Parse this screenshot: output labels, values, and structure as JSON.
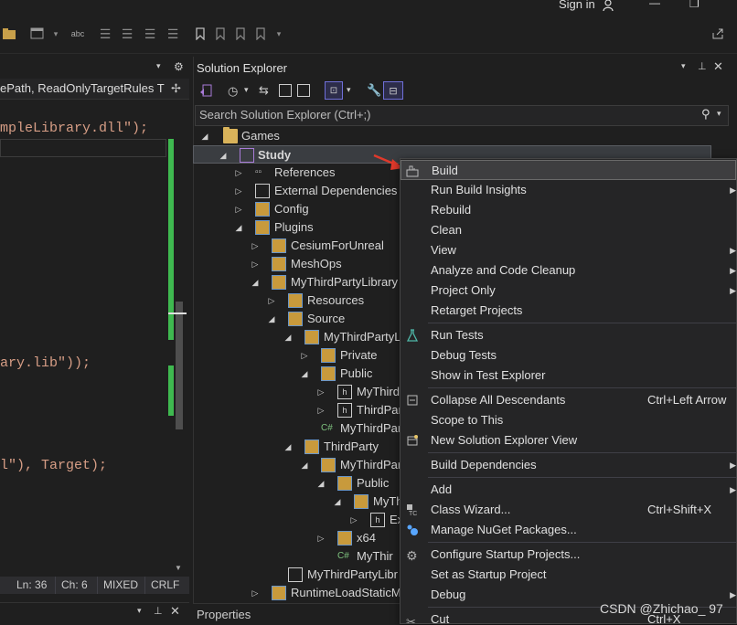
{
  "window": {
    "sign_in": "Sign in",
    "minimize": "—",
    "restore": "❐"
  },
  "editor": {
    "tab_text": "ePath, ReadOnlyTargetRules T",
    "code_lines": [
      {
        "text": "mpleLibrary.dll\");",
        "color": "#d69d85"
      },
      {
        "text": "ary.lib\"));",
        "color": "#d69d85"
      },
      {
        "text": "l\"), Target);",
        "color": "#d69d85"
      }
    ],
    "status": {
      "ln": "Ln: 36",
      "ch": "Ch: 6",
      "mode": "MIXED",
      "eol": "CRLF"
    }
  },
  "solution_explorer": {
    "title": "Solution Explorer",
    "search_placeholder": "Search Solution Explorer (Ctrl+;)",
    "tree": [
      {
        "label": "Games",
        "bold": false
      },
      {
        "label": "Study",
        "bold": true
      },
      {
        "label": "References"
      },
      {
        "label": "External Dependencies"
      },
      {
        "label": "Config"
      },
      {
        "label": "Plugins"
      },
      {
        "label": "CesiumForUnreal"
      },
      {
        "label": "MeshOps"
      },
      {
        "label": "MyThirdPartyLibrary"
      },
      {
        "label": "Resources"
      },
      {
        "label": "Source"
      },
      {
        "label": "MyThirdPartyL"
      },
      {
        "label": "Private"
      },
      {
        "label": "Public"
      },
      {
        "label": "MyThird"
      },
      {
        "label": "ThirdPar"
      },
      {
        "label": "MyThirdPar"
      },
      {
        "label": "ThirdParty"
      },
      {
        "label": "MyThirdPar"
      },
      {
        "label": "Public"
      },
      {
        "label": "MyTh"
      },
      {
        "label": "Ex"
      },
      {
        "label": "x64"
      },
      {
        "label": "MyThir"
      },
      {
        "label": "MyThirdPartyLibr"
      },
      {
        "label": "RuntimeLoadStaticM"
      }
    ],
    "properties_label": "Properties"
  },
  "context_menu": {
    "items": [
      {
        "label": "Build",
        "shortcut": "",
        "sub": false,
        "icon": "build-icon"
      },
      {
        "label": "Run Build Insights",
        "shortcut": "",
        "sub": true
      },
      {
        "label": "Rebuild",
        "shortcut": "",
        "sub": false
      },
      {
        "label": "Clean",
        "shortcut": "",
        "sub": false
      },
      {
        "label": "View",
        "shortcut": "",
        "sub": true
      },
      {
        "label": "Analyze and Code Cleanup",
        "shortcut": "",
        "sub": true
      },
      {
        "label": "Project Only",
        "shortcut": "",
        "sub": true
      },
      {
        "label": "Retarget Projects",
        "shortcut": "",
        "sub": false
      },
      {
        "label": "Run Tests",
        "shortcut": "",
        "sub": false,
        "icon": "flask-icon"
      },
      {
        "label": "Debug Tests",
        "shortcut": "",
        "sub": false
      },
      {
        "label": "Show in Test Explorer",
        "shortcut": "",
        "sub": false
      },
      {
        "label": "Collapse All Descendants",
        "shortcut": "Ctrl+Left Arrow",
        "sub": false,
        "icon": "collapse-icon"
      },
      {
        "label": "Scope to This",
        "shortcut": "",
        "sub": false
      },
      {
        "label": "New Solution Explorer View",
        "shortcut": "",
        "sub": false,
        "icon": "new-view-icon"
      },
      {
        "label": "Build Dependencies",
        "shortcut": "",
        "sub": true
      },
      {
        "label": "Add",
        "shortcut": "",
        "sub": true
      },
      {
        "label": "Class Wizard...",
        "shortcut": "Ctrl+Shift+X",
        "sub": false,
        "icon": "class-wizard-icon"
      },
      {
        "label": "Manage NuGet Packages...",
        "shortcut": "",
        "sub": false,
        "icon": "nuget-icon"
      },
      {
        "label": "Configure Startup Projects...",
        "shortcut": "",
        "sub": false,
        "icon": "gear-icon"
      },
      {
        "label": "Set as Startup Project",
        "shortcut": "",
        "sub": false
      },
      {
        "label": "Debug",
        "shortcut": "",
        "sub": true
      },
      {
        "label": "Cut",
        "shortcut": "Ctrl+X",
        "sub": false,
        "icon": "cut-icon"
      }
    ]
  },
  "watermark": "CSDN @Zhichao_ 97",
  "colors": {
    "accent": "#0e639c",
    "selection": "#3a3d41",
    "arrow": "#e0392b",
    "green_bar": "#3fb950"
  }
}
